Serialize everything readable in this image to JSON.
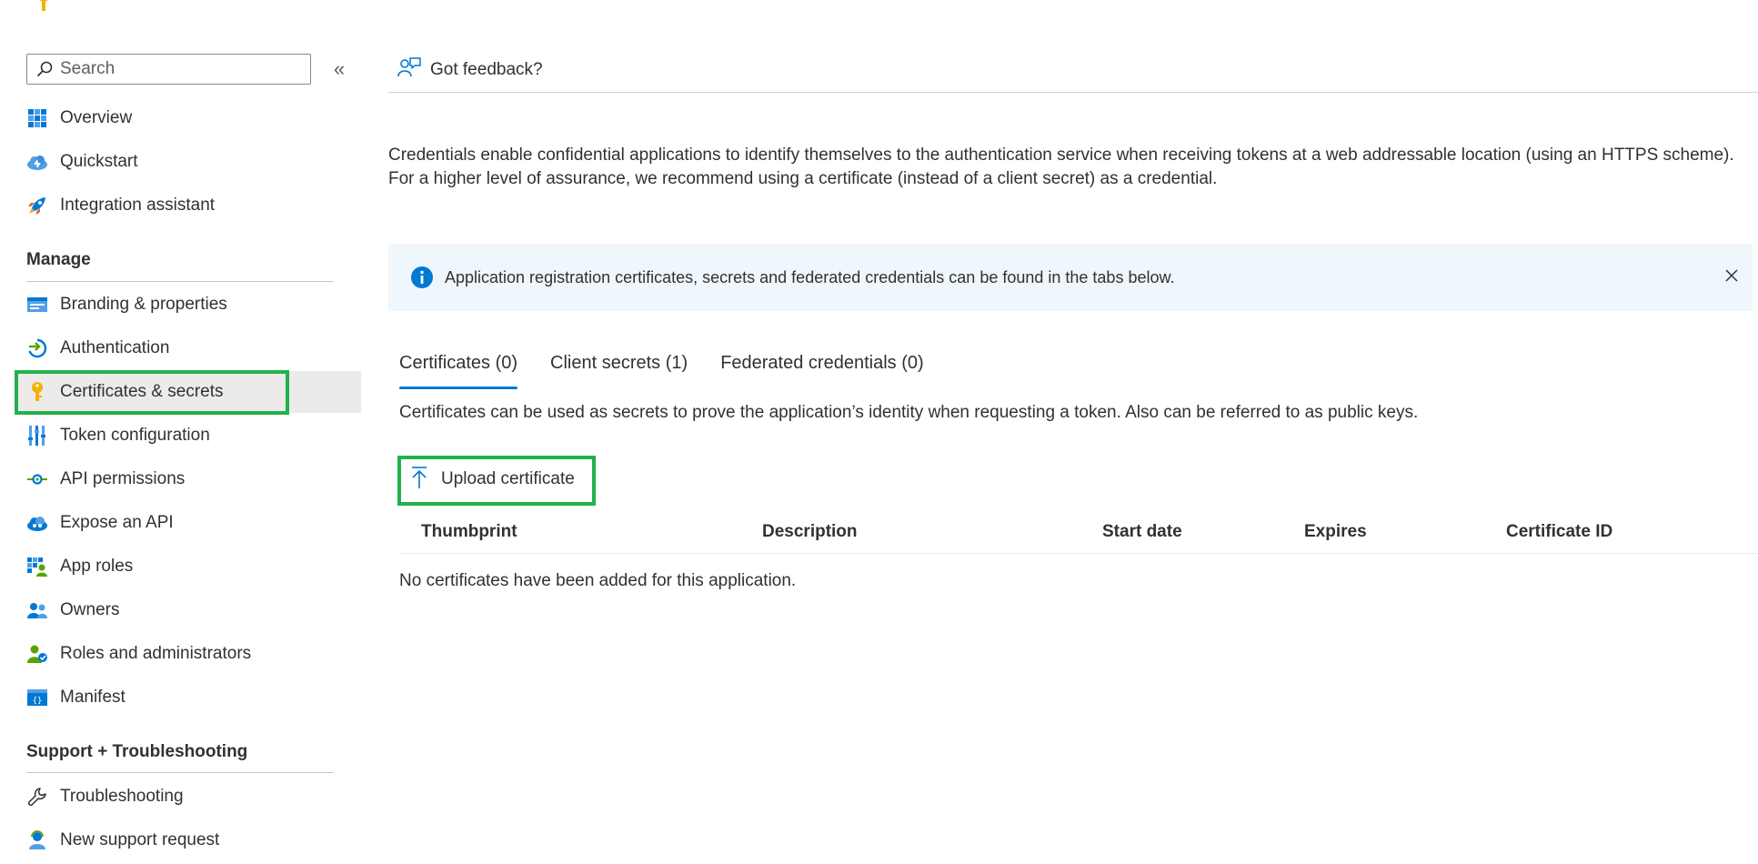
{
  "sidebar": {
    "search_placeholder": "Search",
    "collapse_glyph": "«",
    "items_top": [
      {
        "label": "Overview",
        "icon": "overview-grid-icon"
      },
      {
        "label": "Quickstart",
        "icon": "quickstart-cloud-icon"
      },
      {
        "label": "Integration assistant",
        "icon": "rocket-icon"
      }
    ],
    "manage_heading": "Manage",
    "manage_items": [
      {
        "label": "Branding & properties",
        "icon": "branding-icon"
      },
      {
        "label": "Authentication",
        "icon": "authentication-icon"
      },
      {
        "label": "Certificates & secrets",
        "icon": "key-icon",
        "selected": true
      },
      {
        "label": "Token configuration",
        "icon": "token-bars-icon"
      },
      {
        "label": "API permissions",
        "icon": "api-permissions-icon"
      },
      {
        "label": "Expose an API",
        "icon": "expose-api-cloud-icon"
      },
      {
        "label": "App roles",
        "icon": "app-roles-icon"
      },
      {
        "label": "Owners",
        "icon": "owners-icon"
      },
      {
        "label": "Roles and administrators",
        "icon": "roles-admin-icon"
      },
      {
        "label": "Manifest",
        "icon": "manifest-icon"
      }
    ],
    "support_heading": "Support + Troubleshooting",
    "support_items": [
      {
        "label": "Troubleshooting",
        "icon": "wrench-icon"
      },
      {
        "label": "New support request",
        "icon": "support-person-icon"
      }
    ]
  },
  "main": {
    "feedback_label": "Got feedback?",
    "description": "Credentials enable confidential applications to identify themselves to the authentication service when receiving tokens at a web addressable location (using an HTTPS scheme). For a higher level of assurance, we recommend using a certificate (instead of a client secret) as a credential.",
    "info_message": "Application registration certificates, secrets and federated credentials can be found in the tabs below.",
    "tabs": [
      {
        "label": "Certificates (0)",
        "active": true
      },
      {
        "label": "Client secrets (1)"
      },
      {
        "label": "Federated credentials (0)"
      }
    ],
    "tab_description": "Certificates can be used as secrets to prove the application’s identity when requesting a token. Also can be referred to as public keys.",
    "upload_label": "Upload certificate",
    "table_columns": [
      "Thumbprint",
      "Description",
      "Start date",
      "Expires",
      "Certificate ID"
    ],
    "empty_message": "No certificates have been added for this application."
  },
  "colors": {
    "accent": "#0078d4",
    "highlight_box": "#22b14c",
    "info_background": "#eff6fc",
    "selected_background": "#edebe9"
  }
}
